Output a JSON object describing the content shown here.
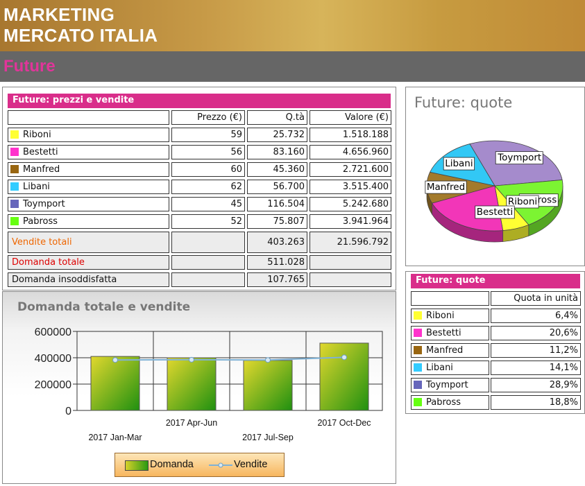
{
  "header": {
    "line1": "MARKETING",
    "line2": "MERCATO ITALIA",
    "section": "Future"
  },
  "prices_table": {
    "title": "Future: prezzi e vendite",
    "headers": [
      "",
      "Prezzo (€)",
      "Q.tà",
      "Valore (€)"
    ],
    "rows": [
      {
        "name": "Riboni",
        "color": "#ffff33",
        "price": "59",
        "qty": "25.732",
        "value": "1.518.188"
      },
      {
        "name": "Bestetti",
        "color": "#ff33cc",
        "price": "56",
        "qty": "83.160",
        "value": "4.656.960"
      },
      {
        "name": "Manfred",
        "color": "#996611",
        "price": "60",
        "qty": "45.360",
        "value": "2.721.600"
      },
      {
        "name": "Libani",
        "color": "#33ccff",
        "price": "62",
        "qty": "56.700",
        "value": "3.515.400"
      },
      {
        "name": "Toymport",
        "color": "#6666bb",
        "price": "45",
        "qty": "116.504",
        "value": "5.242.680"
      },
      {
        "name": "Pabross",
        "color": "#66ff11",
        "price": "52",
        "qty": "75.807",
        "value": "3.941.964"
      }
    ],
    "totals": [
      {
        "label": "Vendite totali",
        "color": "#ee6600",
        "qty": "403.263",
        "value": "21.596.792"
      },
      {
        "label": "Domanda totale",
        "color": "#dd0000",
        "qty": "511.028",
        "value": ""
      },
      {
        "label": "Domanda insoddisfatta",
        "color": "#111111",
        "qty": "107.765",
        "value": ""
      }
    ]
  },
  "pie_panel": {
    "title": "Future: quote"
  },
  "quote_table": {
    "title": "Future: quote",
    "header": "Quota in unità",
    "rows": [
      {
        "name": "Riboni",
        "color": "#ffff33",
        "share": "6,4%"
      },
      {
        "name": "Bestetti",
        "color": "#ff33cc",
        "share": "20,6%"
      },
      {
        "name": "Manfred",
        "color": "#996611",
        "share": "11,2%"
      },
      {
        "name": "Libani",
        "color": "#33ccff",
        "share": "14,1%"
      },
      {
        "name": "Toymport",
        "color": "#6666bb",
        "share": "28,9%"
      },
      {
        "name": "Pabross",
        "color": "#66ff11",
        "share": "18,8%"
      }
    ]
  },
  "chart_data": [
    {
      "type": "bar",
      "title": "Domanda totale e vendite",
      "categories": [
        "2017 Jan-Mar",
        "2017 Apr-Jun",
        "2017 Jul-Sep",
        "2017 Oct-Dec"
      ],
      "series": [
        {
          "name": "Domanda",
          "kind": "bar",
          "values": [
            410000,
            400000,
            380000,
            511028
          ]
        },
        {
          "name": "Vendite",
          "kind": "line",
          "values": [
            383000,
            385000,
            383000,
            403263
          ]
        }
      ],
      "yticks": [
        "600000",
        "400000",
        "200000",
        "0"
      ],
      "ylim": [
        0,
        600000
      ],
      "legend": "bottom"
    },
    {
      "type": "pie",
      "title": "Future: quote",
      "labels": [
        "Toymport",
        "Pabross",
        "Riboni",
        "Bestetti",
        "Manfred",
        "Libani"
      ],
      "values": [
        28.9,
        18.8,
        6.4,
        20.6,
        11.2,
        14.1
      ],
      "colors": [
        "#a58bcc",
        "#7cf432",
        "#ffff33",
        "#f236b8",
        "#a37a2b",
        "#32c8f5"
      ]
    }
  ]
}
